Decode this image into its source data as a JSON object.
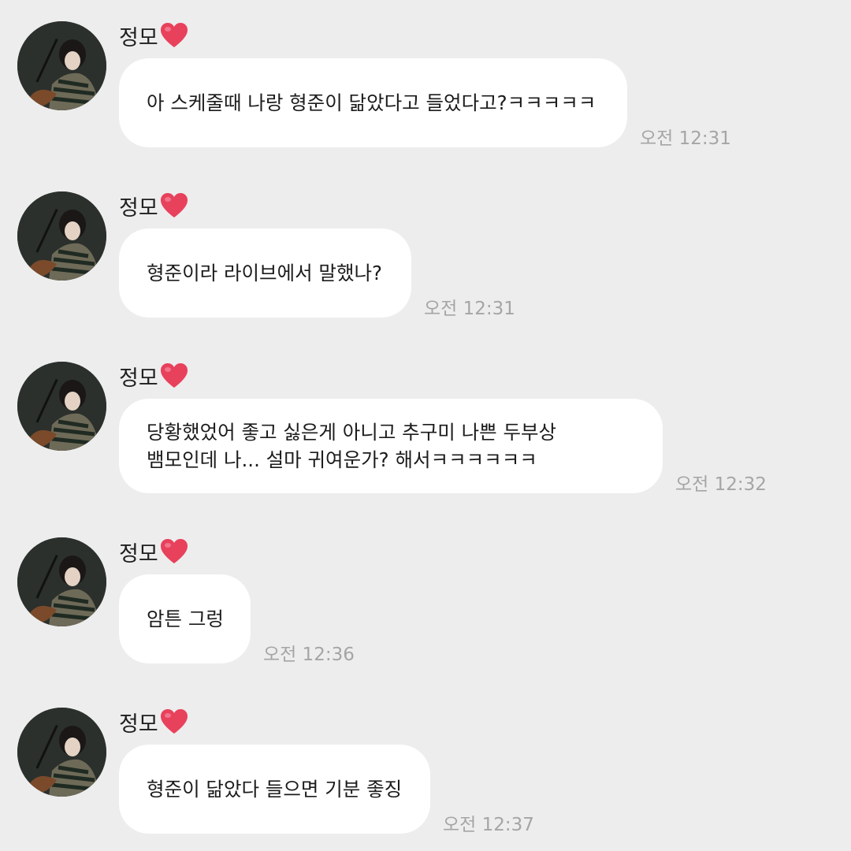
{
  "messages": [
    {
      "sender": "정모",
      "text": "아 스케줄때 나랑 형준이 닮았다고 들었다고?ㅋㅋㅋㅋㅋ",
      "time": "오전 12:31"
    },
    {
      "sender": "정모",
      "text": "형준이라 라이브에서 말했나?",
      "time": "오전 12:31"
    },
    {
      "sender": "정모",
      "text": "당황했었어 좋고 싫은게 아니고 추구미 나쁜 두부상\n뱀모인데 나... 설마 귀여운가? 해서ㅋㅋㅋㅋㅋㅋ",
      "time": "오전 12:32"
    },
    {
      "sender": "정모",
      "text": "암튼 그렁",
      "time": "오전 12:36"
    },
    {
      "sender": "정모",
      "text": "형준이 닮았다 들으면 기분 좋징",
      "time": "오전 12:37"
    }
  ],
  "colors": {
    "background": "#ededed",
    "bubble": "#ffffff",
    "timestamp": "#a5a5a5",
    "heart": "#e8415c"
  },
  "icons": {
    "heart": "heart-icon",
    "avatar": "profile-photo"
  }
}
